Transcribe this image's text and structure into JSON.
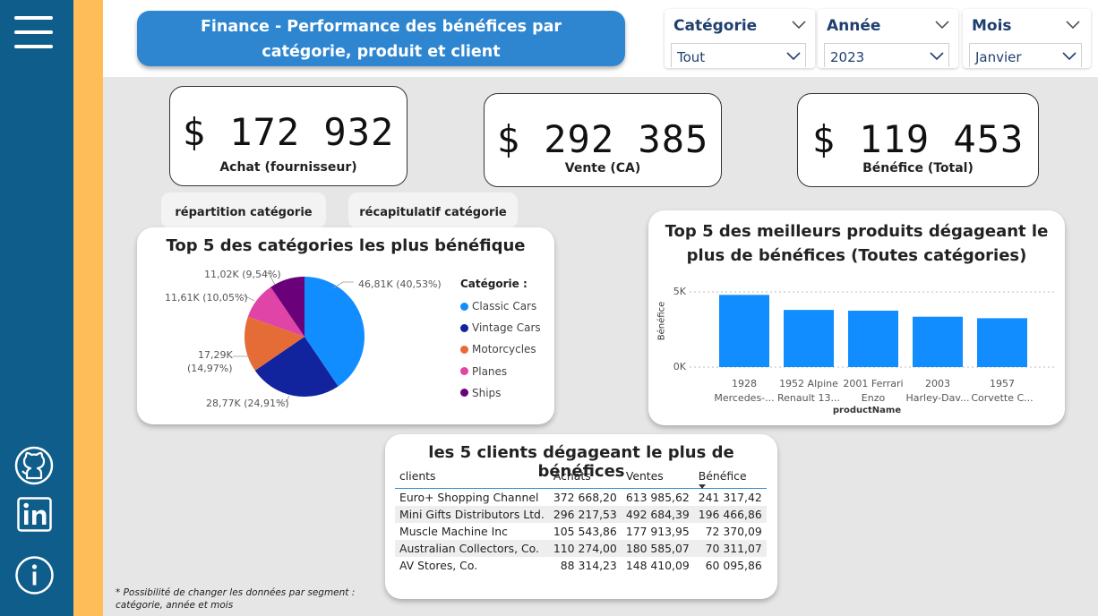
{
  "header": {
    "title_line1": "Finance - Performance des bénéfices par",
    "title_line2": "catégorie, produit et client"
  },
  "slicers": [
    {
      "label": "Catégorie",
      "value": "Tout"
    },
    {
      "label": "Année",
      "value": "2023"
    },
    {
      "label": "Mois",
      "value": "Janvier"
    }
  ],
  "kpis": [
    {
      "value": "$ 172 932",
      "label": "Achat (fournisseur)"
    },
    {
      "value": "$ 292 385",
      "label": "Vente (CA)"
    },
    {
      "value": "$ 119 453",
      "label": "Bénéfice (Total)"
    }
  ],
  "tabs": {
    "tab1": "répartition catégorie",
    "tab2": "récapitulatif catégorie"
  },
  "sidebar": {
    "menu_icon": "hamburger-icon",
    "icons": [
      "github-icon",
      "linkedin-icon",
      "info-icon"
    ]
  },
  "colors": {
    "sidebar": "#0f5d8a",
    "accent_stripe": "#ffbd59",
    "title_bg": "#2f86d0",
    "bar": "#118dff"
  },
  "pie_chart": {
    "title": "Top 5 des catégories les plus bénéfique",
    "legend_title": "Catégorie :",
    "labels": [
      "46,81K (40,53%)",
      "28,77K (24,91%)",
      "17,29K",
      "(14,97%)",
      "11,61K (10,05%)",
      "11,02K (9,54%)"
    ]
  },
  "bar_chart": {
    "title_line1": "Top 5 des meilleurs produits dégageant le",
    "title_line2": "plus de bénéfices (Toutes catégories)",
    "y_ticks": [
      "5K",
      "0K"
    ],
    "ylabel": "Bénéfice",
    "xlabel": "productName",
    "category_lines": [
      [
        "1928",
        "Mercedes-..."
      ],
      [
        "1952 Alpine",
        "Renault 13..."
      ],
      [
        "2001 Ferrari",
        "Enzo"
      ],
      [
        "2003",
        "Harley-Dav..."
      ],
      [
        "1957",
        "Corvette C..."
      ]
    ]
  },
  "clients_table": {
    "title": "les 5 clients dégageant le plus de bénéfices",
    "columns": [
      "clients",
      "Achats",
      "Ventes",
      "Bénéfice"
    ],
    "rows": [
      [
        "Euro+ Shopping Channel",
        "372 668,20",
        "613 985,62",
        "241 317,42"
      ],
      [
        "Mini Gifts Distributors Ltd.",
        "296 217,53",
        "492 684,39",
        "196 466,86"
      ],
      [
        "Muscle Machine Inc",
        "105 543,86",
        "177 913,95",
        "72 370,09"
      ],
      [
        "Australian Collectors, Co.",
        "110 274,00",
        "180 585,07",
        "70 311,07"
      ],
      [
        "AV Stores, Co.",
        "88 314,23",
        "148 410,09",
        "60 095,86"
      ]
    ]
  },
  "footnote": {
    "line1": "* Possibilité de changer les données par segment :",
    "line2": "catégorie, année et mois"
  },
  "chart_data": [
    {
      "type": "pie",
      "title": "Top 5 des catégories les plus bénéfique",
      "legend_title": "Catégorie :",
      "legend_position": "right",
      "categories": [
        "Classic Cars",
        "Vintage Cars",
        "Motorcycles",
        "Planes",
        "Ships"
      ],
      "values": [
        46.81,
        28.77,
        17.29,
        11.61,
        11.02
      ],
      "percents": [
        40.53,
        24.91,
        14.97,
        10.05,
        9.54
      ],
      "colors": [
        "#118dff",
        "#12239e",
        "#e66c37",
        "#e044a7",
        "#6b007b"
      ]
    },
    {
      "type": "bar",
      "title": "Top 5 des meilleurs produits dégageant le plus de bénéfices (Toutes catégories)",
      "xlabel": "productName",
      "ylabel": "Bénéfice",
      "categories": [
        "1928 Mercedes-...",
        "1952 Alpine Renault 13...",
        "2001 Ferrari Enzo",
        "2003 Harley-Dav...",
        "1957 Corvette C..."
      ],
      "values": [
        4800,
        3800,
        3750,
        3350,
        3250
      ],
      "ylim": [
        0,
        5000
      ],
      "grid": true,
      "color": "#118dff"
    }
  ]
}
